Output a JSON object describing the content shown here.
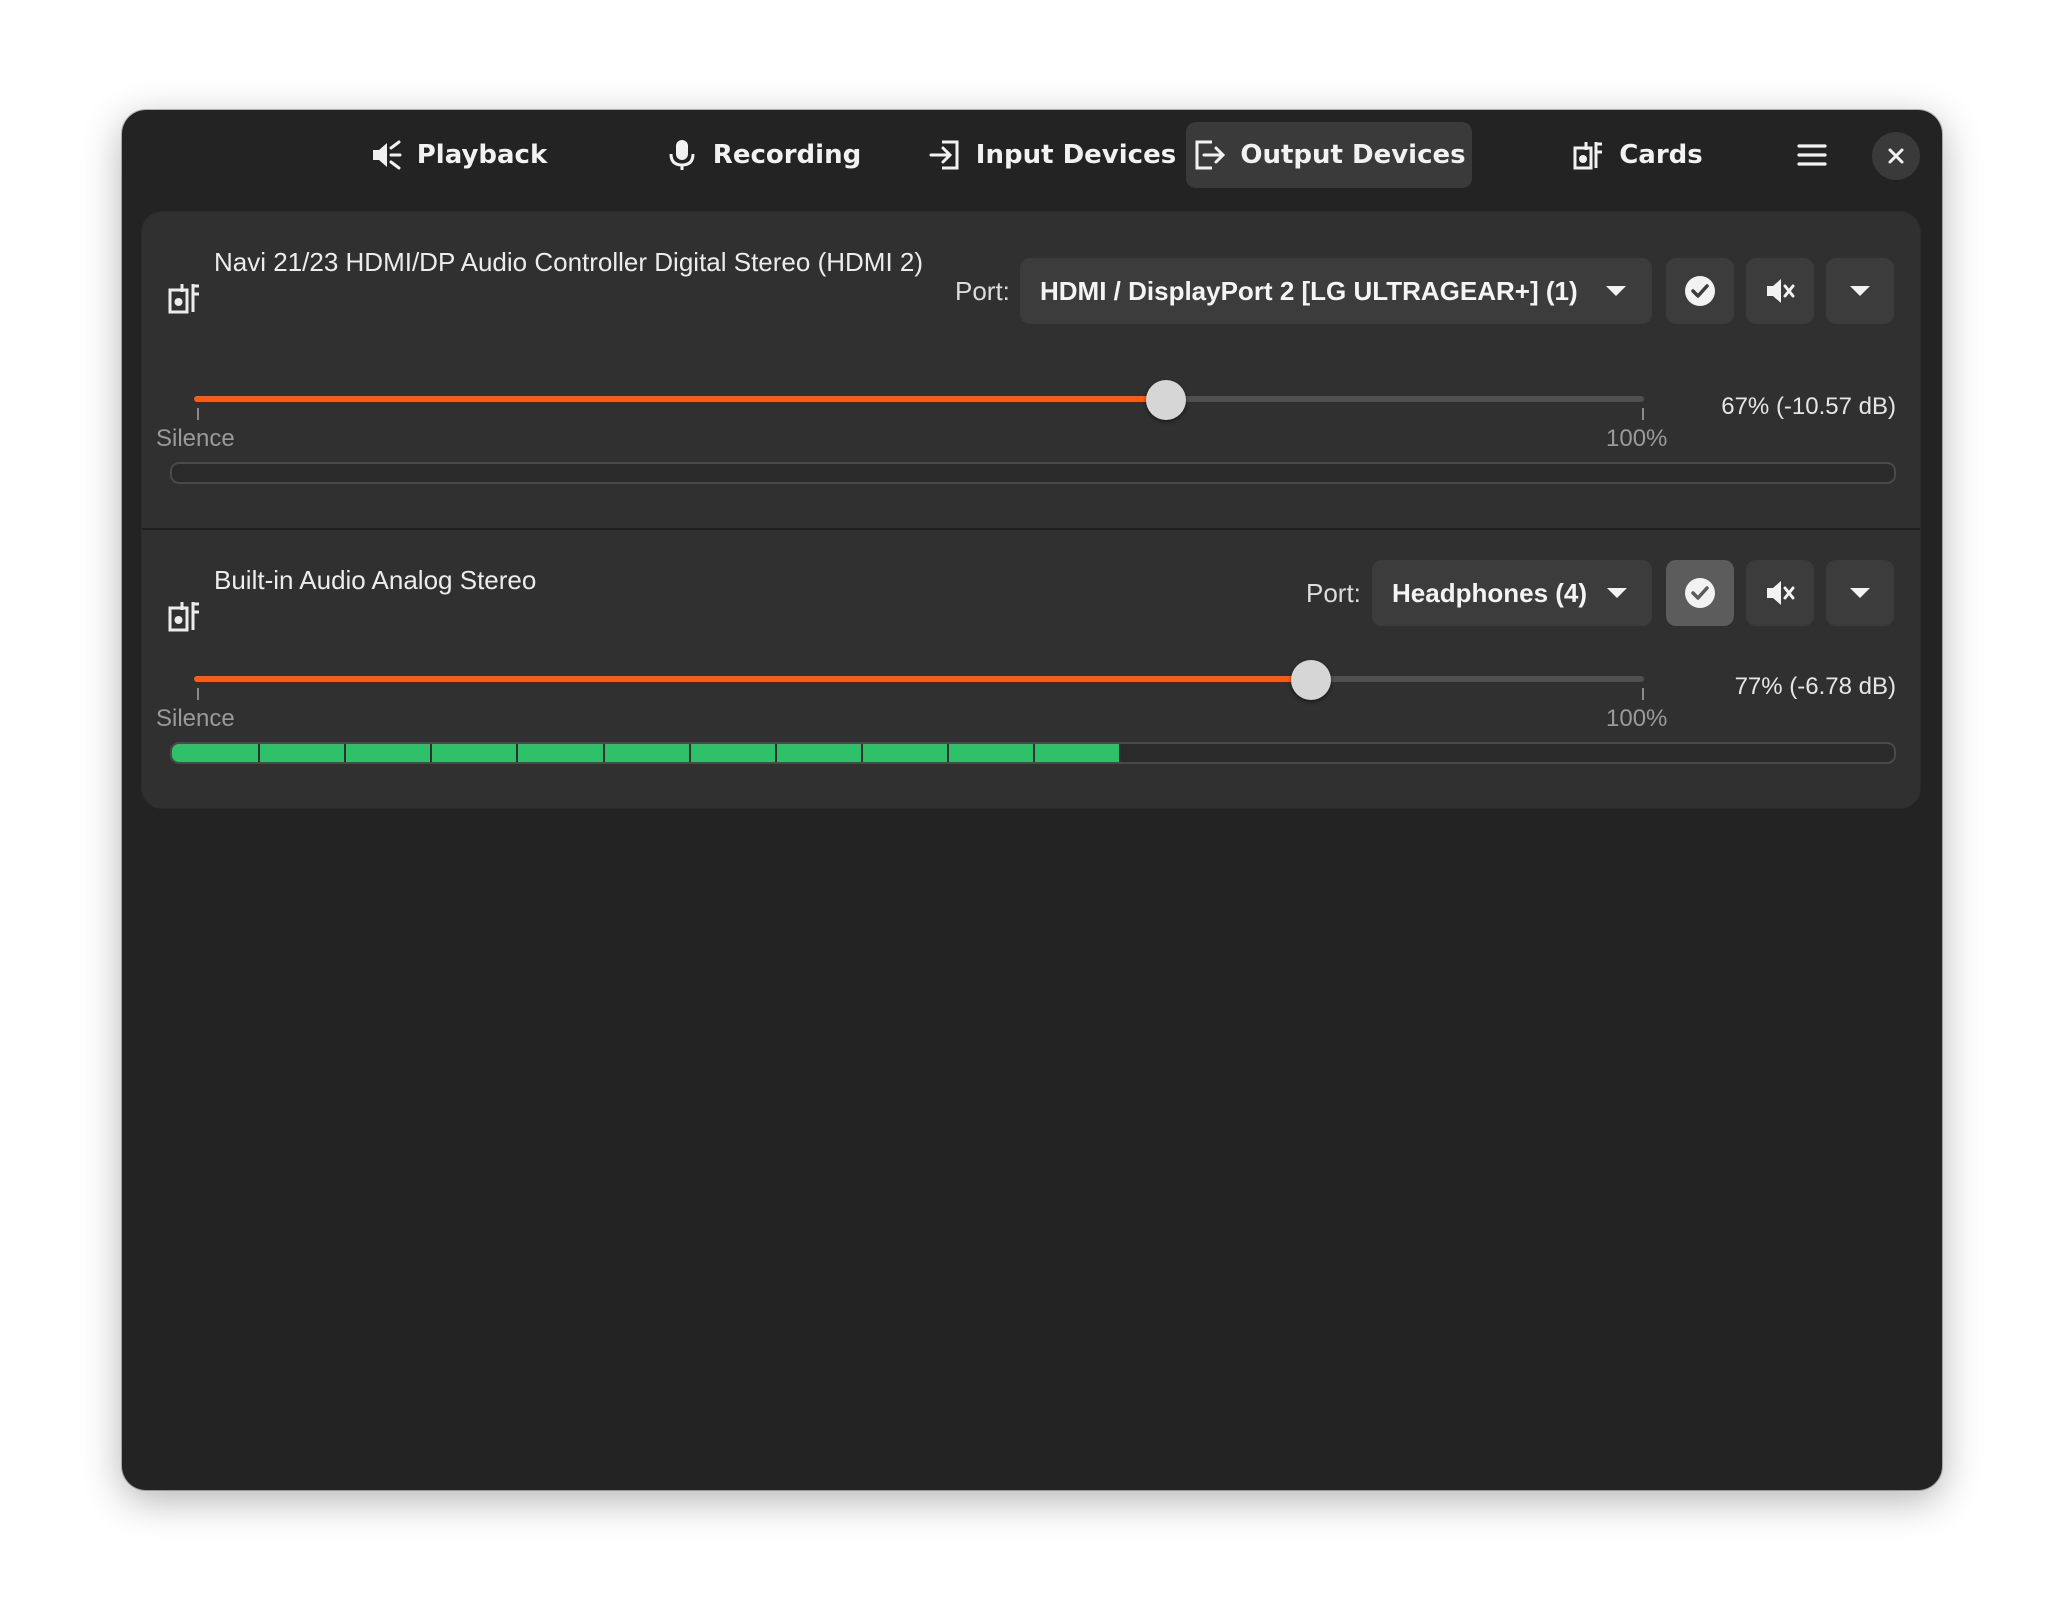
{
  "tabs": [
    {
      "label": "Playback",
      "icon": "speaker-icon",
      "active": false
    },
    {
      "label": "Recording",
      "icon": "microphone-icon",
      "active": false
    },
    {
      "label": "Input Devices",
      "icon": "input-devices-icon",
      "active": false
    },
    {
      "label": "Output Devices",
      "icon": "output-devices-icon",
      "active": true
    },
    {
      "label": "Cards",
      "icon": "sound-card-icon",
      "active": false
    }
  ],
  "header": {
    "menu_icon": "hamburger-menu-icon",
    "close_icon": "close-icon"
  },
  "devices": [
    {
      "name": "Navi 21/23 HDMI/DP Audio Controller Digital Stereo (HDMI 2)",
      "port_label": "Port:",
      "port_value": "HDMI / DisplayPort 2 [LG ULTRAGEAR+] (1)",
      "default_checked": false,
      "volume_percent": 67,
      "volume_readout": "67% (-10.57 dB)",
      "mark_min": "Silence",
      "mark_max": "100%",
      "level_fraction": 0.0
    },
    {
      "name": "Built-in Audio Analog Stereo",
      "port_label": "Port:",
      "port_value": "Headphones (4)",
      "default_checked": true,
      "volume_percent": 77,
      "volume_readout": "77% (-6.78 dB)",
      "mark_min": "Silence",
      "mark_max": "100%",
      "level_fraction": 0.55
    }
  ],
  "colors": {
    "window_bg": "#232323",
    "card_bg": "#303030",
    "accent": "#ff5a12",
    "level_meter": "#2ec16a",
    "button_bg": "#3c3c3c",
    "button_checked_bg": "#5c5c5c"
  }
}
